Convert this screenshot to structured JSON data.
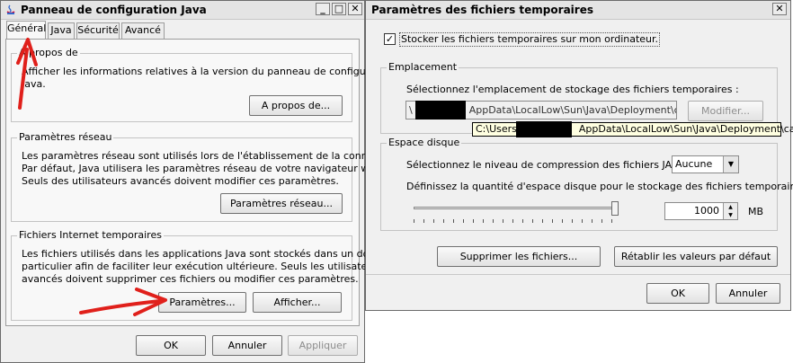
{
  "left_window": {
    "title": "Panneau de configuration Java",
    "tabs": [
      "Général",
      "Java",
      "Sécurité",
      "Avancé"
    ],
    "about": {
      "title": "A propos de",
      "line1": "Afficher les informations relatives à la version du panneau de configuration",
      "line2": "Java.",
      "button": "A propos de..."
    },
    "network": {
      "title": "Paramètres réseau",
      "line1": "Les paramètres réseau sont utilisés lors de l'établissement de la connexion.",
      "line2": "Par défaut, Java utilisera les paramètres réseau de votre navigateur web.",
      "line3": "Seuls des utilisateurs avancés doivent modifier ces paramètres.",
      "button": "Paramètres réseau..."
    },
    "temp_files": {
      "title": "Fichiers Internet temporaires",
      "line1": "Les fichiers utilisés dans les applications Java sont stockés dans un dossier",
      "line2": "particulier afin de faciliter leur exécution ultérieure. Seuls les utilisateurs",
      "line3": "avancés doivent supprimer ces fichiers ou modifier ces paramètres.",
      "settings_button": "Paramètres...",
      "view_button": "Afficher..."
    },
    "footer": {
      "ok": "OK",
      "cancel": "Annuler",
      "apply": "Appliquer"
    }
  },
  "right_window": {
    "title": "Paramètres des fichiers temporaires",
    "keep_checkbox": {
      "label": "Stocker les fichiers temporaires sur mon ordinateur.",
      "checked": true
    },
    "location": {
      "title": "Emplacement",
      "prompt": "Sélectionnez l'emplacement de stockage des fichiers temporaires :",
      "path_prefix": "\\",
      "path_suffix": "AppData\\LocalLow\\Sun\\Java\\Deployment\\cache",
      "modify_button": "Modifier...",
      "tooltip_prefix": "C:\\Users",
      "tooltip_suffix": "AppData\\LocalLow\\Sun\\Java\\Deployment\\cache"
    },
    "disk": {
      "title": "Espace disque",
      "compression_label": "Sélectionnez le niveau de compression des fichiers JAR :",
      "compression_value": "Aucune",
      "space_label": "Définissez la quantité d'espace disque pour le stockage des fichiers temporaires :",
      "space_value": "1000",
      "space_unit": "MB"
    },
    "delete_button": "Supprimer les fichiers...",
    "restore_button": "Rétablir les valeurs par défaut",
    "footer": {
      "ok": "OK",
      "cancel": "Annuler"
    }
  },
  "colors": {
    "annotation_arrow": "#e0201b"
  }
}
